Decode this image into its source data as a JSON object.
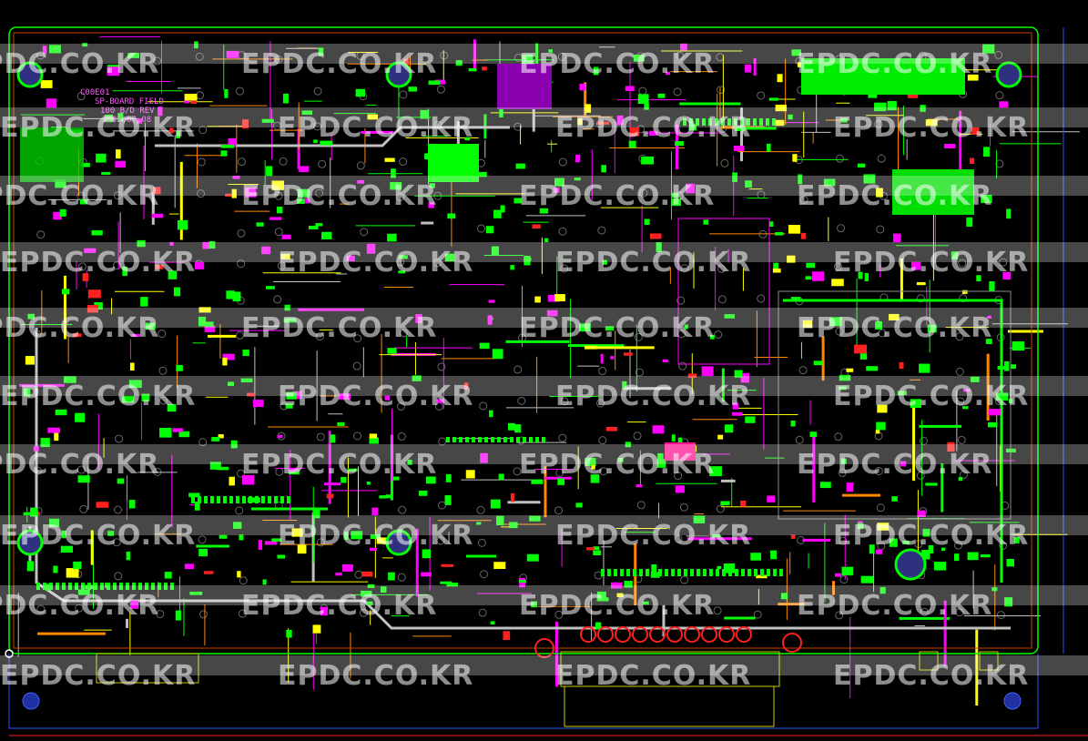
{
  "watermark": {
    "text": "EPDC.CO.KR",
    "color": "#ffffff"
  },
  "board_silkscreen": {
    "lines": [
      "C00E01",
      "SP-BOARD FIELD",
      "100 B/D REV",
      "2005.07.08"
    ]
  },
  "colors": {
    "background": "#000000",
    "board_outline": "#00ff00",
    "copper_green": "#00ff00",
    "silkscreen_magenta": "#ff00ff",
    "pad_red": "#ff2020",
    "trace_yellow": "#ffff00",
    "trace_orange": "#ff8800",
    "via_gray": "#c0c0c0",
    "mount_blue": "#4060ff",
    "purple_block": "#8a00b0",
    "pink_block": "#ff1090",
    "dimension_blue": "#3050ff"
  },
  "icons": {
    "mount_hole": "circle-icon",
    "connector_pin": "circle-icon"
  }
}
